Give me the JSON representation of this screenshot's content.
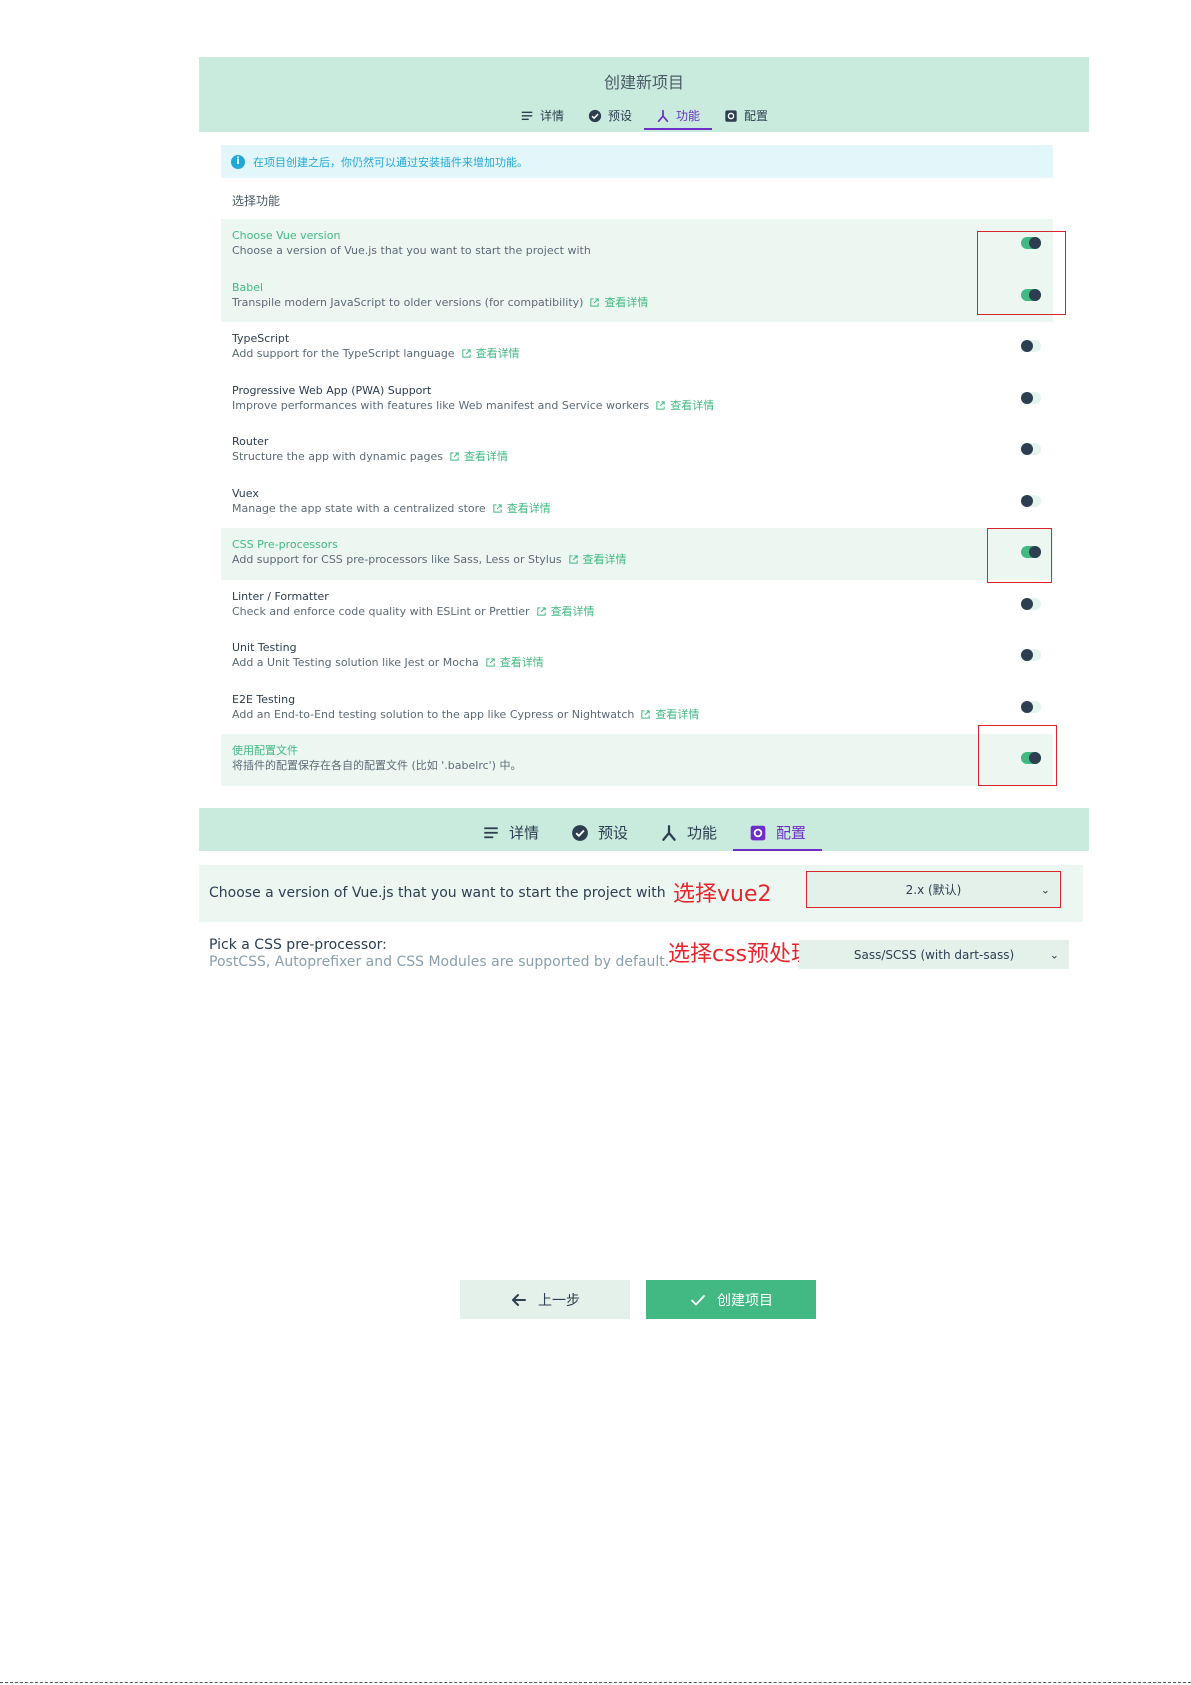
{
  "header": {
    "title": "创建新项目",
    "tabs": [
      {
        "label": "详情",
        "icon": "list-icon",
        "active": false
      },
      {
        "label": "预设",
        "icon": "check-circle-icon",
        "active": false
      },
      {
        "label": "功能",
        "icon": "fork-icon",
        "active": true
      },
      {
        "label": "配置",
        "icon": "settings-box-icon",
        "active": false
      }
    ]
  },
  "info_banner": {
    "icon": "info-icon",
    "text": "在项目创建之后，你仍然可以通过安装插件来增加功能。"
  },
  "features_section": {
    "label": "选择功能",
    "link_label": "查看详情",
    "items": [
      {
        "name": "Choose Vue version",
        "description": "Choose a version of Vue.js that you want to start the project with",
        "has_link": false,
        "enabled": true
      },
      {
        "name": "Babel",
        "description": "Transpile modern JavaScript to older versions (for compatibility)",
        "has_link": true,
        "enabled": true
      },
      {
        "name": "TypeScript",
        "description": "Add support for the TypeScript language",
        "has_link": true,
        "enabled": false
      },
      {
        "name": "Progressive Web App (PWA) Support",
        "description": "Improve performances with features like Web manifest and Service workers",
        "has_link": true,
        "enabled": false
      },
      {
        "name": "Router",
        "description": "Structure the app with dynamic pages",
        "has_link": true,
        "enabled": false
      },
      {
        "name": "Vuex",
        "description": "Manage the app state with a centralized store",
        "has_link": true,
        "enabled": false
      },
      {
        "name": "CSS Pre-processors",
        "description": "Add support for CSS pre-processors like Sass, Less or Stylus",
        "has_link": true,
        "enabled": true
      },
      {
        "name": "Linter / Formatter",
        "description": "Check and enforce code quality with ESLint or Prettier",
        "has_link": true,
        "enabled": false
      },
      {
        "name": "Unit Testing",
        "description": "Add a Unit Testing solution like Jest or Mocha",
        "has_link": true,
        "enabled": false
      },
      {
        "name": "E2E Testing",
        "description": "Add an End-to-End testing solution to the app like Cypress or Nightwatch",
        "has_link": true,
        "enabled": false
      },
      {
        "name": "使用配置文件",
        "description": "将插件的配置保存在各自的配置文件 (比如 '.babelrc') 中。",
        "has_link": false,
        "enabled": true
      }
    ]
  },
  "config_tabs": [
    {
      "label": "详情",
      "icon": "list-icon",
      "active": false
    },
    {
      "label": "预设",
      "icon": "check-circle-icon",
      "active": false
    },
    {
      "label": "功能",
      "icon": "fork-icon",
      "active": false
    },
    {
      "label": "配置",
      "icon": "settings-box-icon",
      "active": true
    }
  ],
  "config": {
    "vue_version": {
      "label": "Choose a version of Vue.js that you want to start the project with",
      "selected": "2.x (默认)",
      "annotation": "选择vue2"
    },
    "css_preprocessor": {
      "label": "Pick a CSS pre-processor:",
      "sublabel": "PostCSS, Autoprefixer and CSS Modules are supported by default.",
      "selected": "Sass/SCSS (with dart-sass)",
      "annotation": "选择css预处理"
    }
  },
  "buttons": {
    "prev": "上一步",
    "create": "创建项目"
  },
  "colors": {
    "header_bg": "#c9ebdd",
    "accent_green": "#42b983",
    "active_tab": "#6e2fc9",
    "info_blue": "#22a8d6",
    "annotation_red": "#e8262c"
  }
}
